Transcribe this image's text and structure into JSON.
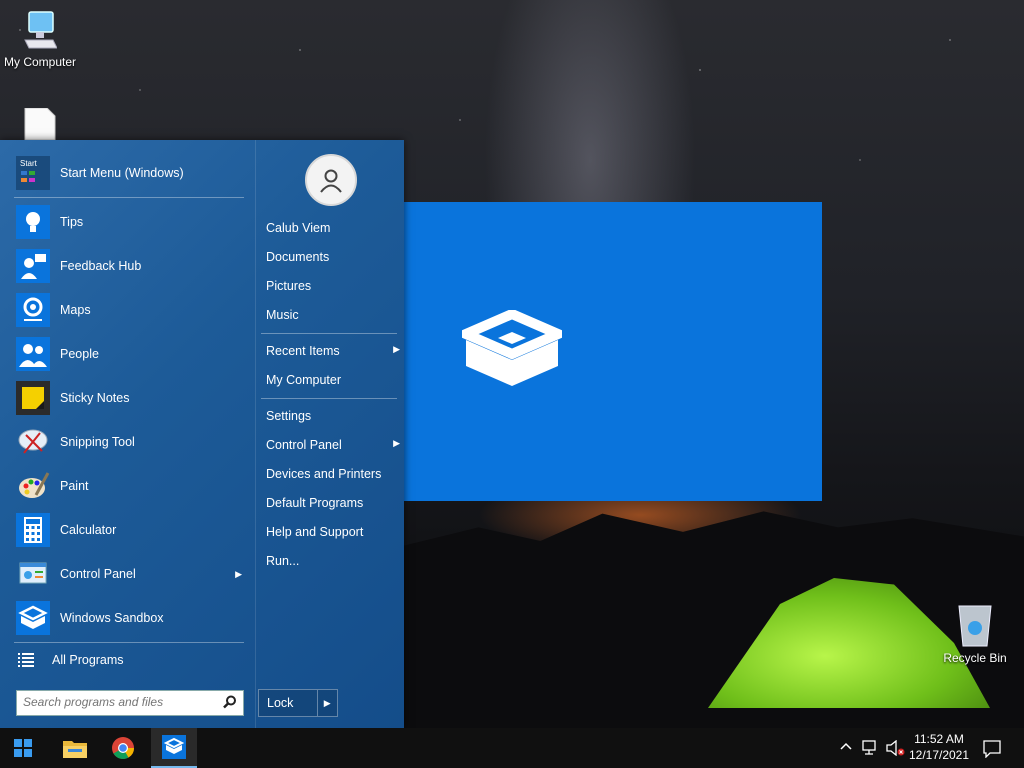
{
  "desktop": {
    "icons": {
      "my_computer": "My Computer",
      "recycle_bin": "Recycle Bin"
    }
  },
  "start_menu": {
    "header_app": {
      "label": "Start Menu (Windows)",
      "icon_text": "Start"
    },
    "programs": [
      {
        "label": "Tips",
        "icon": "lightbulb-icon"
      },
      {
        "label": "Feedback Hub",
        "icon": "feedback-hub-icon"
      },
      {
        "label": "Maps",
        "icon": "maps-icon"
      },
      {
        "label": "People",
        "icon": "people-icon"
      },
      {
        "label": "Sticky Notes",
        "icon": "sticky-notes-icon"
      },
      {
        "label": "Snipping Tool",
        "icon": "snipping-tool-icon"
      },
      {
        "label": "Paint",
        "icon": "paint-icon"
      },
      {
        "label": "Calculator",
        "icon": "calculator-icon"
      },
      {
        "label": "Control Panel",
        "icon": "control-panel-icon",
        "has_submenu": true
      },
      {
        "label": "Windows Sandbox",
        "icon": "sandbox-icon"
      }
    ],
    "all_programs": "All Programs",
    "search_placeholder": "Search programs and files",
    "right": {
      "user_name": "Calub Viem",
      "items_group1": [
        "Documents",
        "Pictures",
        "Music"
      ],
      "recent_items": "Recent Items",
      "my_computer": "My Computer",
      "settings": "Settings",
      "control_panel": "Control Panel",
      "devices_printers": "Devices and Printers",
      "default_programs": "Default Programs",
      "help_support": "Help and Support",
      "run": "Run..."
    },
    "lock_label": "Lock"
  },
  "taskbar": {
    "pinned": [
      "start-button",
      "file-explorer-icon",
      "chrome-icon",
      "sandbox-icon"
    ],
    "time": "11:52 AM",
    "date": "12/17/2021"
  },
  "colors": {
    "menu_blue": "#1d5b98",
    "sandbox_blue": "#0a74dc",
    "taskbar": "#101010"
  }
}
